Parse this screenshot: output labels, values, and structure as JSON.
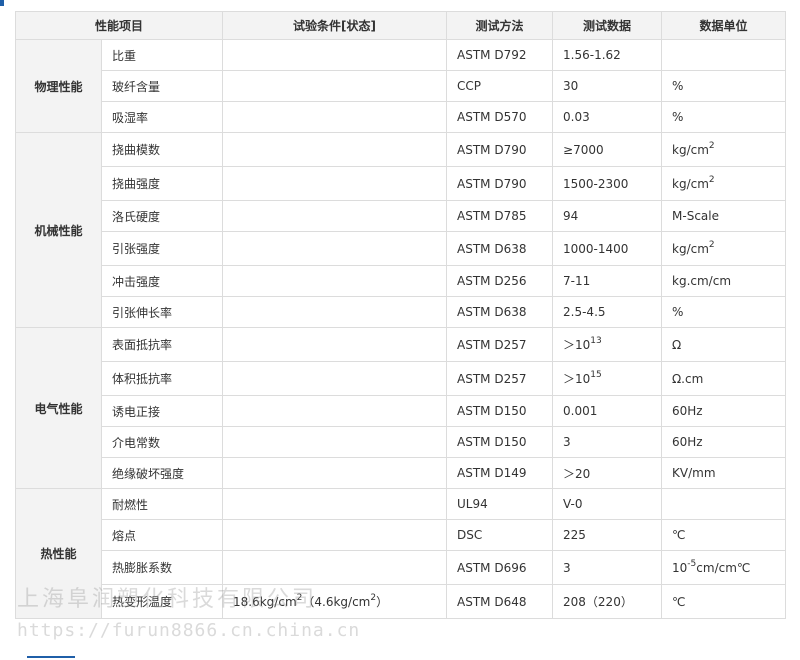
{
  "headers": [
    "性能项目",
    "试验条件[状态]",
    "测试方法",
    "测试数据",
    "数据单位"
  ],
  "groups": [
    {
      "name": "物理性能",
      "rows": [
        {
          "item": "比重",
          "condition": "",
          "method": "ASTM D792",
          "value": "1.56-1.62",
          "unit": ""
        },
        {
          "item": "玻纤含量",
          "condition": "",
          "method": "CCP",
          "value": "30",
          "unit": "%"
        },
        {
          "item": "吸湿率",
          "condition": "",
          "method": "ASTM D570",
          "value": "0.03",
          "unit": "%"
        }
      ]
    },
    {
      "name": "机械性能",
      "rows": [
        {
          "item": "挠曲模数",
          "condition": "",
          "method": "ASTM D790",
          "value": "≥7000",
          "unit": "kg/cm",
          "unit_sup": "2"
        },
        {
          "item": "挠曲强度",
          "condition": "",
          "method": "ASTM D790",
          "value": "1500-2300",
          "unit": "kg/cm",
          "unit_sup": "2"
        },
        {
          "item": "洛氏硬度",
          "condition": "",
          "method": "ASTM D785",
          "value": "94",
          "unit": "M-Scale"
        },
        {
          "item": "引张强度",
          "condition": "",
          "method": "ASTM D638",
          "value": "1000-1400",
          "unit": "kg/cm",
          "unit_sup": "2"
        },
        {
          "item": "冲击强度",
          "condition": "",
          "method": "ASTM D256",
          "value": "7-11",
          "unit": "kg.cm/cm"
        },
        {
          "item": "引张伸长率",
          "condition": "",
          "method": "ASTM D638",
          "value": "2.5-4.5",
          "unit": "%"
        }
      ]
    },
    {
      "name": "电气性能",
      "rows": [
        {
          "item": "表面抵抗率",
          "condition": "",
          "method": "ASTM D257",
          "value": "＞10",
          "value_sup": "13",
          "unit": "Ω"
        },
        {
          "item": "体积抵抗率",
          "condition": "",
          "method": "ASTM D257",
          "value": "＞10",
          "value_sup": "15",
          "unit": "Ω.cm"
        },
        {
          "item": "诱电正接",
          "condition": "",
          "method": "ASTM D150",
          "value": "0.001",
          "unit": "60Hz"
        },
        {
          "item": "介电常数",
          "condition": "",
          "method": "ASTM D150",
          "value": "3",
          "unit": "60Hz"
        },
        {
          "item": "绝缘破坏强度",
          "condition": "",
          "method": "ASTM D149",
          "value": "＞20",
          "unit": "KV/mm"
        }
      ]
    },
    {
      "name": "热性能",
      "rows": [
        {
          "item": "耐燃性",
          "condition": "",
          "method": "UL94",
          "value": "V-0",
          "unit": ""
        },
        {
          "item": "熔点",
          "condition": "",
          "method": "DSC",
          "value": "225",
          "unit": "℃"
        },
        {
          "item": "热膨胀系数",
          "condition": "",
          "method": "ASTM D696",
          "value": "3",
          "unit": "10",
          "unit_sup": "-5",
          "unit_after": "cm/cm℃"
        },
        {
          "item": "热变形温度",
          "condition": "18.6kg/cm",
          "condition_sup": "2",
          "condition_after": "（4.6kg/cm",
          "condition_sup2": "2",
          "condition_after2": "）",
          "method": "ASTM D648",
          "value": "208（220）",
          "unit": "℃"
        }
      ]
    }
  ],
  "watermark": {
    "company": "上海阜润塑化科技有限公司",
    "url": "https://furun8866.cn.china.cn"
  },
  "colors": {
    "accent": "#1f5fa8",
    "header_bg": "#f3f3f3",
    "border": "#dcdcdc",
    "text": "#333333"
  }
}
